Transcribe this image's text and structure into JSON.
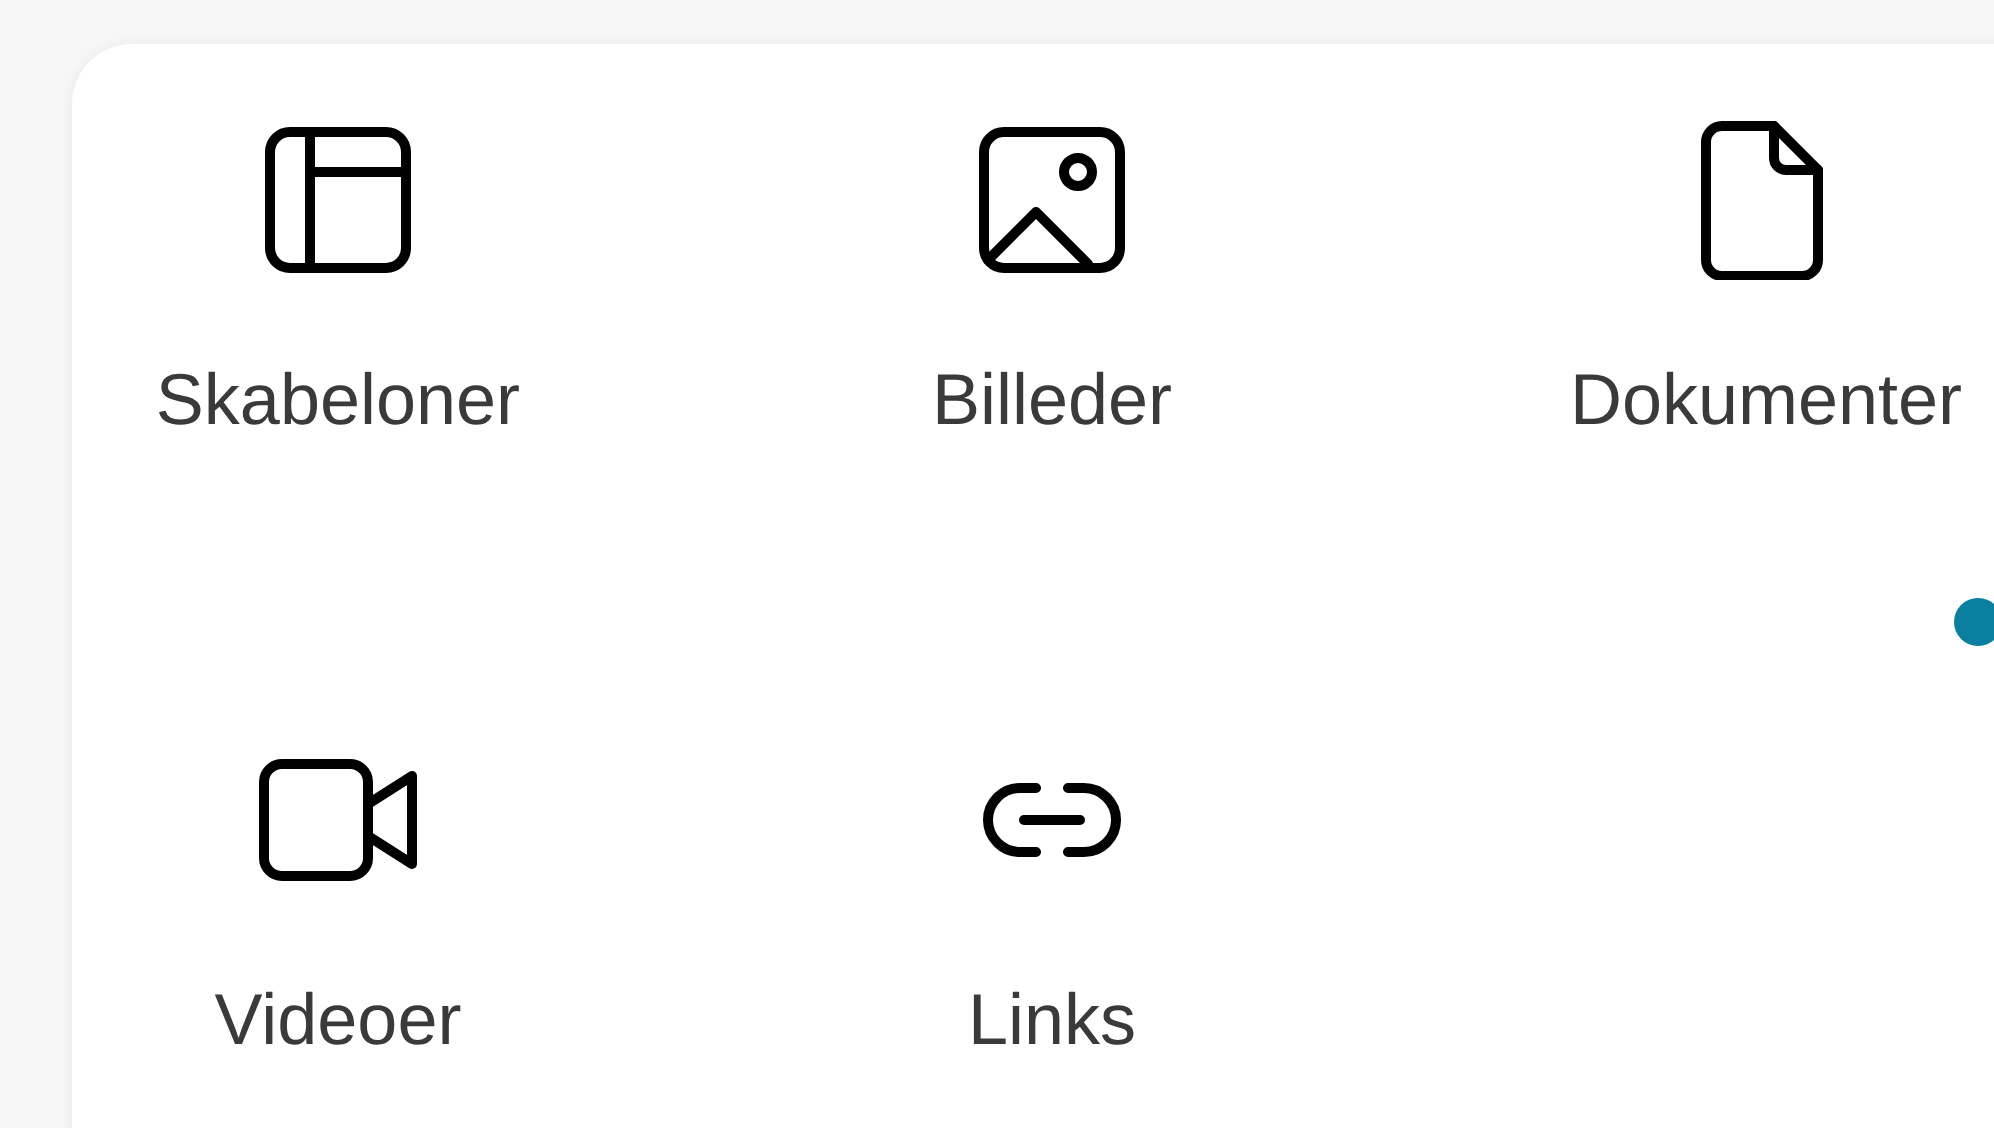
{
  "items": [
    {
      "label": "Skabeloner"
    },
    {
      "label": "Billeder"
    },
    {
      "label": "Dokumenter"
    },
    {
      "label": "Videoer"
    },
    {
      "label": "Links"
    }
  ]
}
